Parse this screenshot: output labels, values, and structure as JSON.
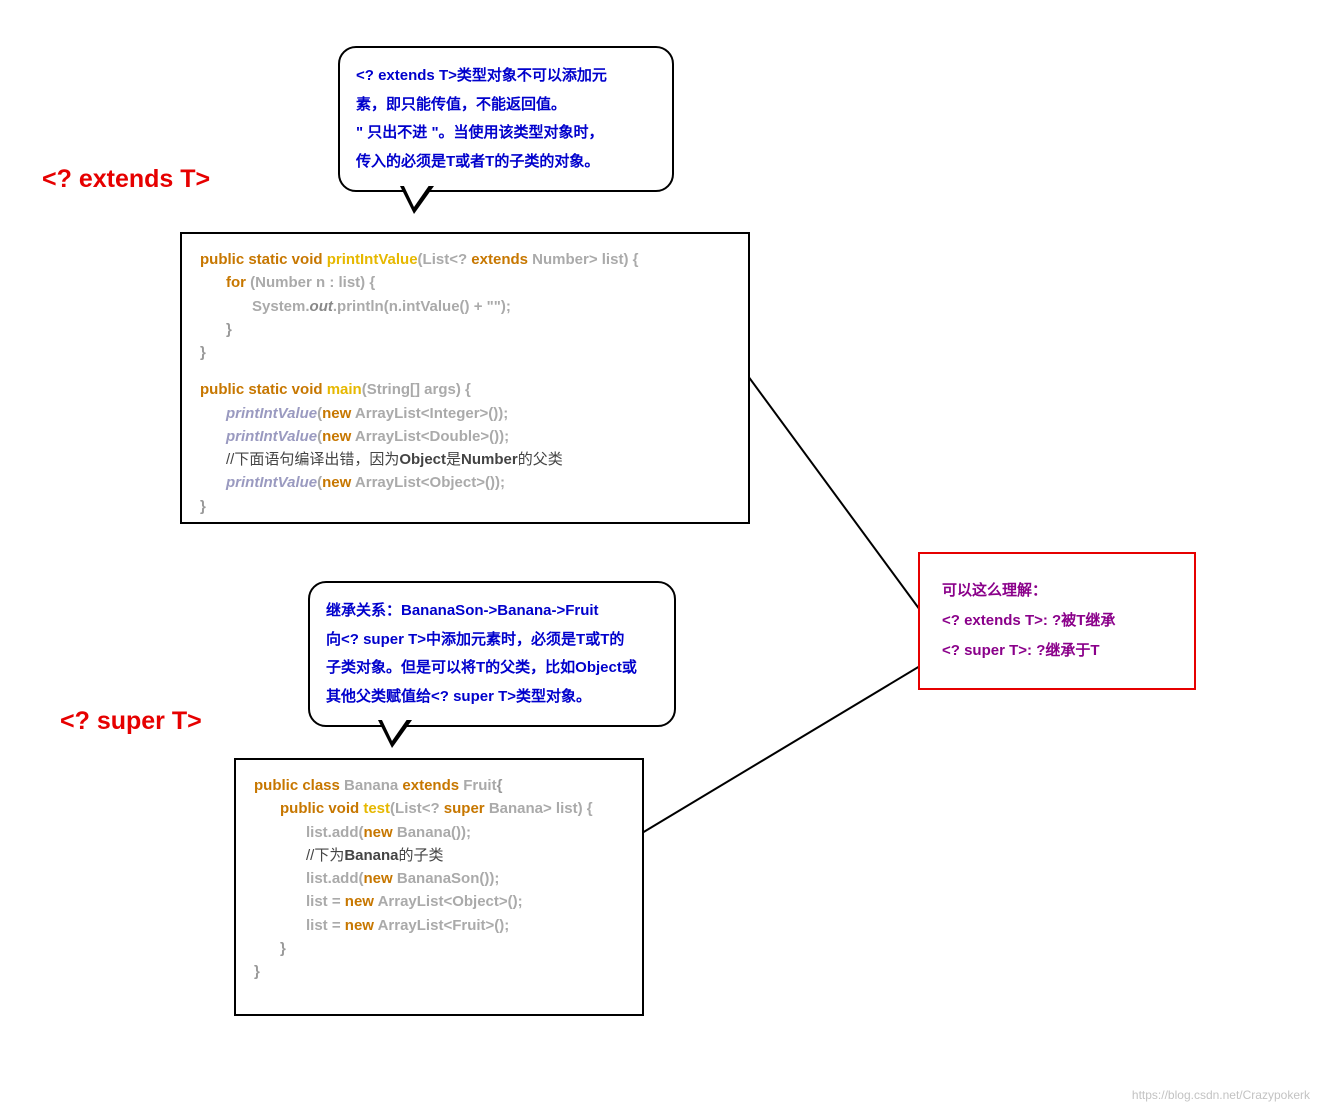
{
  "titles": {
    "extends": "<? extends T>",
    "super": "<? super T>"
  },
  "bubble1": {
    "l1": "<? extends T>类型对象不可以添加元",
    "l2": "素，即只能传值，不能返回值。",
    "l3": "\" 只出不进 \"。当使用该类型对象时，",
    "l4": "传入的必须是T或者T的子类的对象。"
  },
  "bubble2": {
    "l1": "继承关系：BananaSon->Banana->Fruit",
    "l2": "向<? super T>中添加元素时，必须是T或T的",
    "l3": "子类对象。但是可以将T的父类，比如Object或",
    "l4": "其他父类赋值给<? super T>类型对象。"
  },
  "code1": {
    "kw_psv": "public static void ",
    "m_printIntValue": "printIntValue",
    "sig1_rest": "(List<? ",
    "kw_extends": "extends",
    "sig1_tail": " Number> list) {",
    "kw_for": "for",
    "for_rest": " (Number n : list) {",
    "sys": "System.",
    "out": "out",
    "println_rest": ".println(n.intValue() + \"\");",
    "brace_close": "}",
    "m_main": "main",
    "main_sig": "(String[] args) {",
    "call_piv": "printIntValue",
    "kw_new": "new",
    "arr_int": " ArrayList<Integer>());",
    "arr_dbl": " ArrayList<Double>());",
    "comment_pre": "//下面语句编译出错，因为",
    "comment_obj": "Object",
    "comment_mid": "是",
    "comment_num": "Number",
    "comment_tail": "的父类",
    "arr_obj": " ArrayList<Object>());"
  },
  "code2": {
    "kw_pc": "public class ",
    "cls_banana": "Banana",
    "kw_extends2": " extends ",
    "cls_fruit": "Fruit",
    "brace_open": "{",
    "kw_pv": "public void ",
    "m_test": "test",
    "test_sig_a": "(List<? ",
    "kw_super": "super",
    "test_sig_b": " Banana> list) {",
    "list_add": "list.add(",
    "kw_new2": "new",
    "banana_ctor": " Banana());",
    "comment2_pre": "//下为",
    "comment2_banana": "Banana",
    "comment2_tail": "的子类",
    "bananason_ctor": " BananaSon());",
    "list_eq": "list = ",
    "arr_obj2": " ArrayList<Object>();",
    "arr_fruit": " ArrayList<Fruit>();"
  },
  "right_box": {
    "l1": "可以这么理解：",
    "l2": "<? extends T>: ?被T继承",
    "l3": "<? super T>: ?继承于T"
  },
  "watermark": "https://blog.csdn.net/Crazypokerk"
}
